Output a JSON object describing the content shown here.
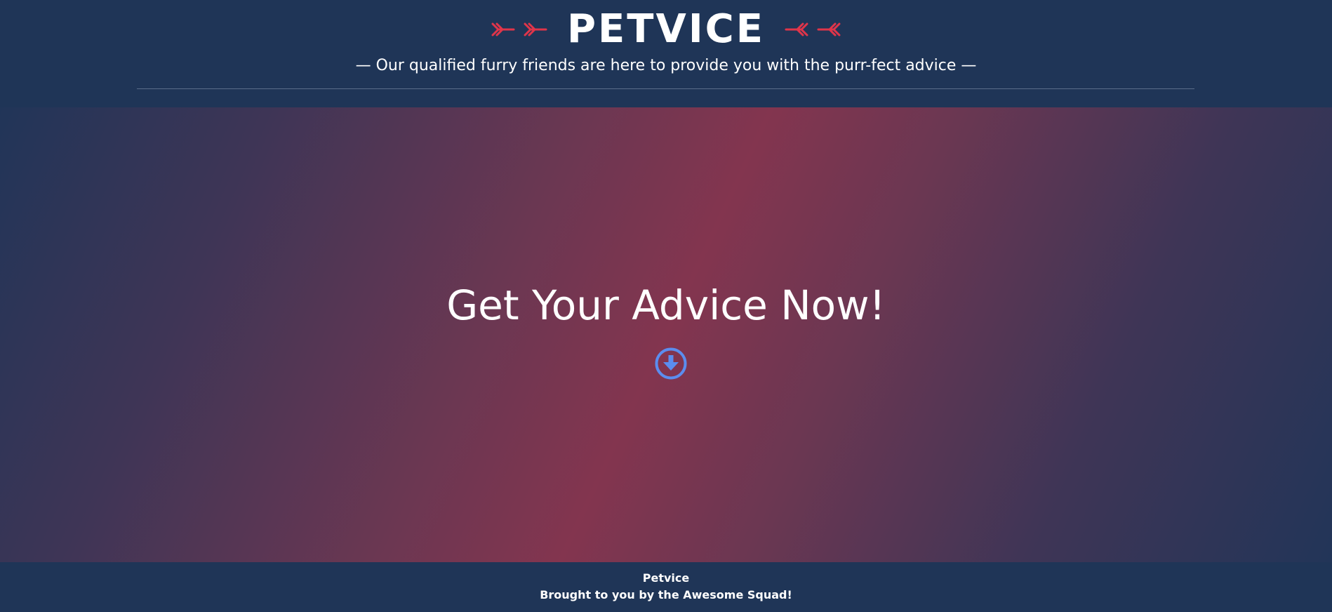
{
  "header": {
    "brand": "PETVICE",
    "tagline": "— Our qualified furry friends are here to provide you with the purr-fect advice —",
    "left_ornament_icon": "double-arrow-right-icon",
    "right_ornament_icon": "double-arrow-left-icon"
  },
  "hero": {
    "title": "Get Your Advice Now!",
    "cta_icon": "arrow-circle-down-icon"
  },
  "footer": {
    "name": "Petvice",
    "credit": "Brought to you by the Awesome Squad!"
  },
  "colors": {
    "background": "#1f3557",
    "accent": "#e0354a",
    "gradient_center": "#83354f",
    "cta": "#5b8def",
    "text": "#ffffff"
  }
}
